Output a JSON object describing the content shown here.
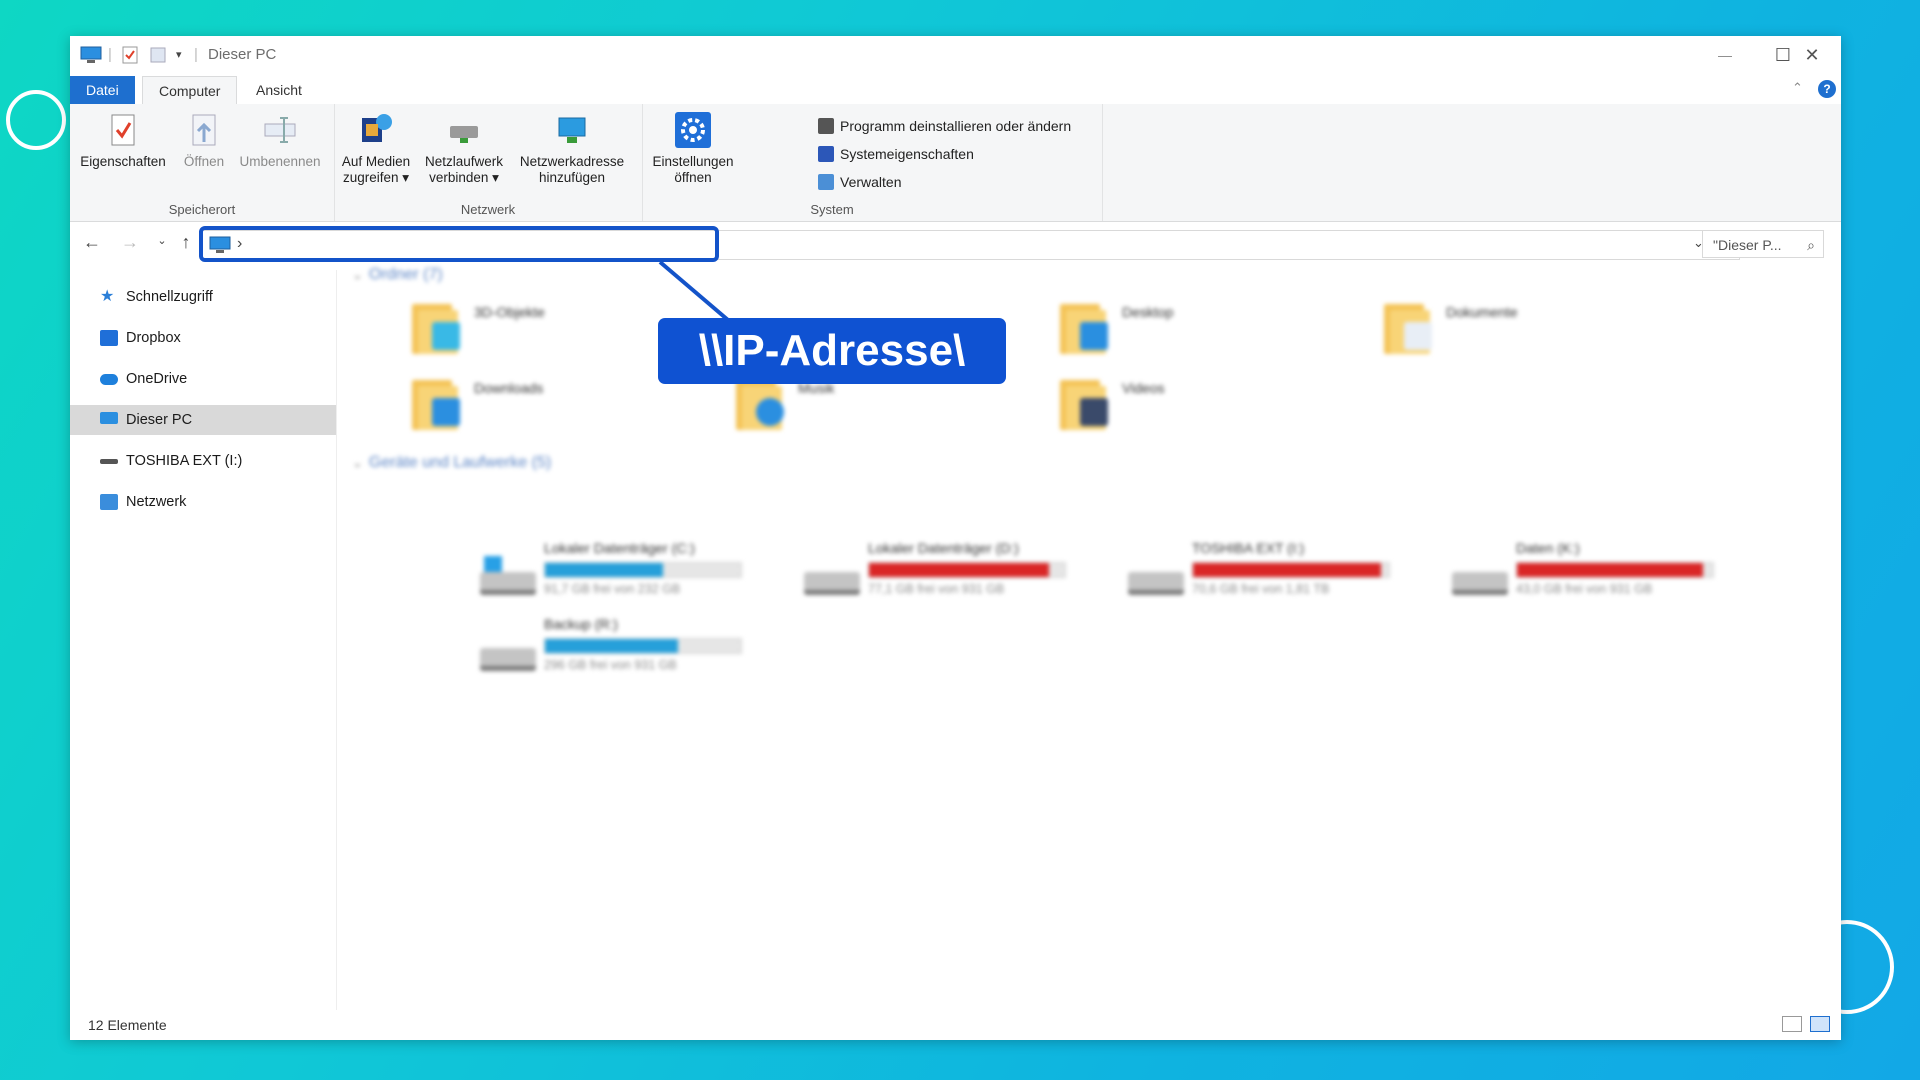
{
  "window": {
    "title": "Dieser PC",
    "buttons": {
      "minimize": "—",
      "maximize": "☐",
      "close": "✕"
    }
  },
  "tabs": [
    {
      "label": "Datei"
    },
    {
      "label": "Computer"
    },
    {
      "label": "Ansicht"
    }
  ],
  "ribbon": {
    "groups": {
      "speicherort": "Speicherort",
      "netzwerk": "Netzwerk",
      "system": "System"
    },
    "buttons": {
      "eigenschaften": "Eigenschaften",
      "oeffnen": "Öffnen",
      "umbenennen": "Umbenennen",
      "medien_1": "Auf Medien",
      "medien_2": "zugreifen ▾",
      "netzlaufwerk_1": "Netzlaufwerk",
      "netzlaufwerk_2": "verbinden ▾",
      "netzwerkadresse_1": "Netzwerkadresse",
      "netzwerkadresse_2": "hinzufügen",
      "einstellungen_1": "Einstellungen",
      "einstellungen_2": "öffnen"
    },
    "system_items": [
      "Programm deinstallieren oder ändern",
      "Systemeigenschaften",
      "Verwalten"
    ]
  },
  "address": {
    "chevron": "›",
    "search_placeholder": "\"Dieser P..."
  },
  "nav": [
    {
      "label": "Schnellzugriff"
    },
    {
      "label": "Dropbox"
    },
    {
      "label": "OneDrive"
    },
    {
      "label": "Dieser PC"
    },
    {
      "label": "TOSHIBA EXT (I:)"
    },
    {
      "label": "Netzwerk"
    }
  ],
  "content": {
    "folders_header": "Ordner (7)",
    "folders": [
      "3D-Objekte",
      "Desktop",
      "Dokumente",
      "Downloads",
      "Musik",
      "Videos"
    ],
    "drives_header": "Geräte und Laufwerke (5)",
    "drives": [
      {
        "name": "Lokaler Datenträger (C:)",
        "free": "91,7 GB frei von 232 GB",
        "used_fraction": 0.6,
        "color": "#26a0da"
      },
      {
        "name": "Lokaler Datenträger (D:)",
        "free": "77,1 GB frei von 931 GB",
        "used_fraction": 0.92,
        "color": "#da2626"
      },
      {
        "name": "TOSHIBA EXT (I:)",
        "free": "70,6 GB frei von 1,81 TB",
        "used_fraction": 0.96,
        "color": "#da2626"
      },
      {
        "name": "Daten (K:)",
        "free": "43,0 GB frei von 931 GB",
        "used_fraction": 0.95,
        "color": "#da2626"
      },
      {
        "name": "Backup (R:)",
        "free": "296 GB frei von 931 GB",
        "used_fraction": 0.68,
        "color": "#26a0da"
      }
    ]
  },
  "status": {
    "count": "12 Elemente"
  },
  "callout": {
    "text": "\\\\IP-Adresse\\"
  }
}
